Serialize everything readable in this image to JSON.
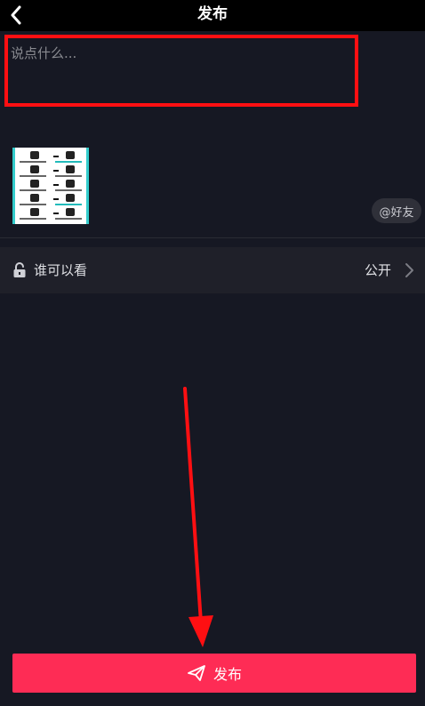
{
  "header": {
    "title": "发布"
  },
  "composer": {
    "caption_placeholder": "说点什么...",
    "mention_label": "@好友"
  },
  "visibility": {
    "label": "谁可以看",
    "value": "公开"
  },
  "publish": {
    "label": "发布"
  },
  "icons": {
    "back": "chevron-left-icon",
    "lock": "unlock-icon",
    "chevron": "chevron-right-icon",
    "send": "paper-plane-icon"
  },
  "colors": {
    "background": "#161823",
    "header": "#000000",
    "accent": "#fe2c55",
    "annotation": "#ff0f12"
  }
}
